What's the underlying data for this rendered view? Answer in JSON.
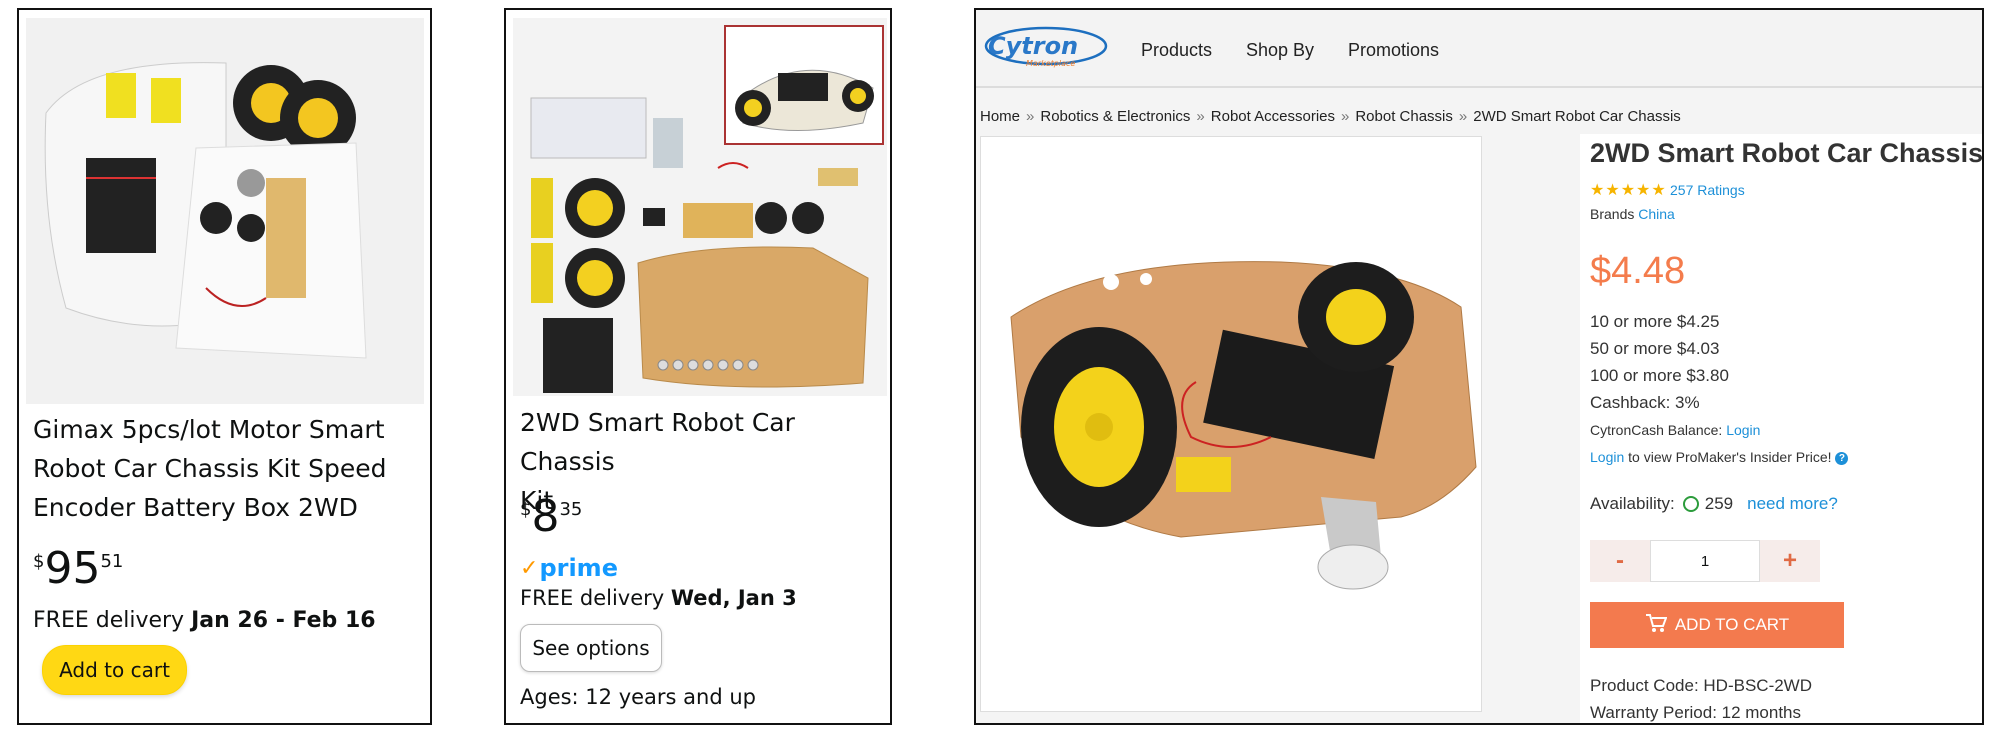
{
  "card1": {
    "title_lines": [
      "Gimax 5pcs/lot Motor Smart",
      "Robot Car Chassis Kit Speed",
      "Encoder Battery Box 2WD"
    ],
    "price": {
      "symbol": "$",
      "whole": "95",
      "fraction": "51"
    },
    "delivery_prefix": "FREE delivery ",
    "delivery_dates": "Jan 26 - Feb 16",
    "add_to_cart_label": "Add to cart"
  },
  "card2": {
    "title_lines": [
      "2WD Smart Robot Car Chassis",
      "Kit"
    ],
    "price": {
      "symbol": "$",
      "whole": "8",
      "fraction": "35"
    },
    "prime_label": "prime",
    "delivery_prefix": "FREE delivery ",
    "delivery_date": "Wed, Jan 3",
    "see_options_label": "See options",
    "ages": "Ages: 12 years and up"
  },
  "card3": {
    "logo_text": "Cytron",
    "logo_sub": "Marketplace",
    "nav": [
      "Products",
      "Shop By",
      "Promotions"
    ],
    "breadcrumbs": [
      "Home",
      "Robotics & Electronics",
      "Robot Accessories",
      "Robot Chassis",
      "2WD Smart Robot Car Chassis"
    ],
    "breadcrumb_sep": "»",
    "title": "2WD Smart Robot Car Chassis",
    "stars": "★★★★★",
    "ratings": "257 Ratings",
    "brands_label": "Brands",
    "brand": "China",
    "price": "$4.48",
    "tiers": [
      "10 or more $4.25",
      "50 or more $4.03",
      "100 or more $3.80",
      "Cashback: 3%"
    ],
    "cytroncash_label": "CytronCash Balance: ",
    "login": "Login",
    "insider_text": " to view ProMaker's Insider Price! ",
    "help": "?",
    "availability_label": "Availability:",
    "availability_count": "259",
    "need_more": "need more?",
    "qty_minus": "-",
    "qty_value": "1",
    "qty_plus": "+",
    "add_to_cart_label": "ADD TO CART",
    "product_code": "Product Code: HD-BSC-2WD",
    "warranty": "Warranty Period: 12 months"
  },
  "colors": {
    "amazon_cart_yellow": "#ffd814",
    "prime_blue": "#1399ff",
    "cytron_orange": "#f37a4e",
    "link_blue": "#1d90d8"
  }
}
